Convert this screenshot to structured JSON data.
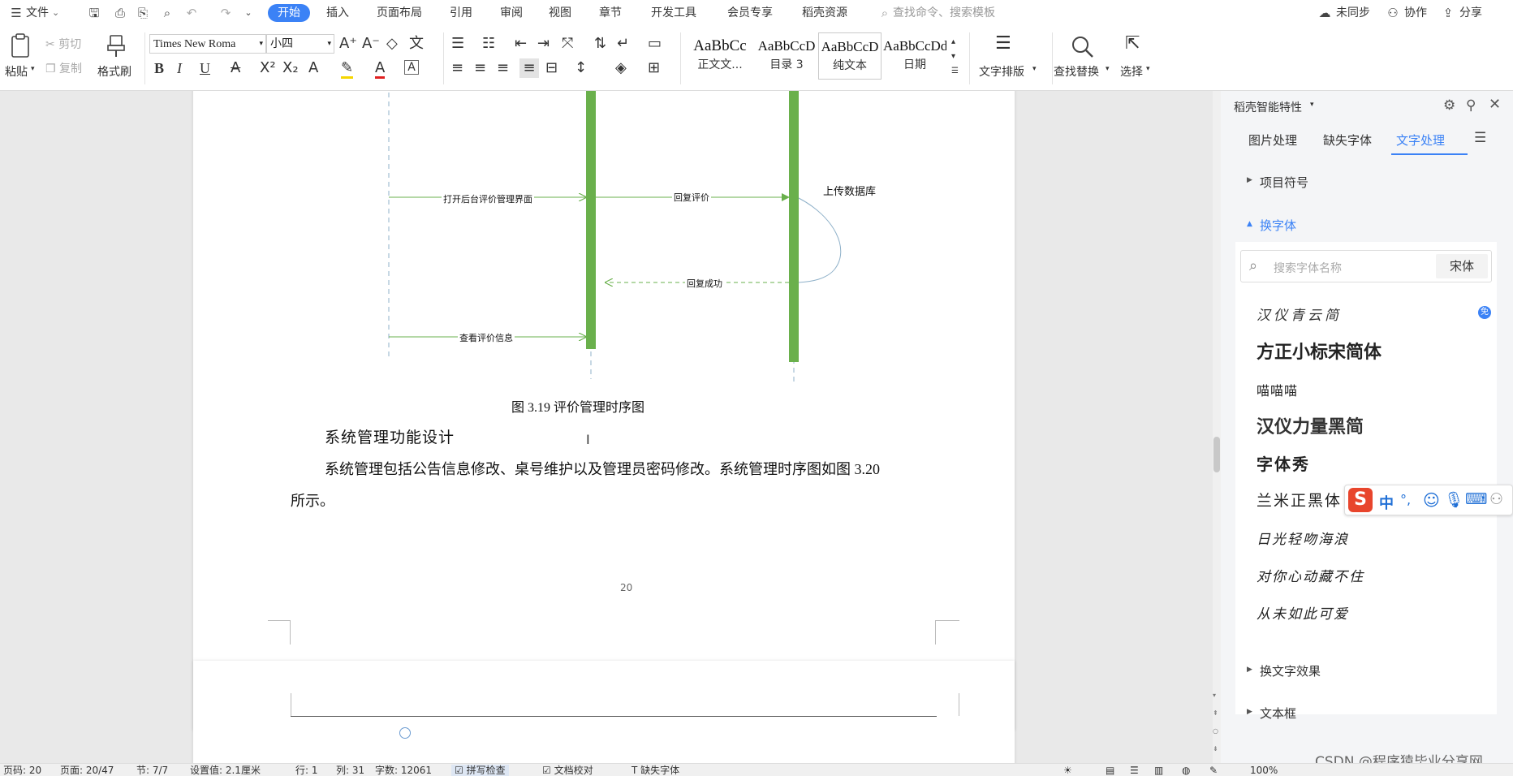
{
  "menubar": {
    "file_label": "文件",
    "tabs": [
      "开始",
      "插入",
      "页面布局",
      "引用",
      "审阅",
      "视图",
      "章节",
      "开发工具",
      "会员专享",
      "稻壳资源"
    ],
    "search_placeholder": "查找命令、搜索模板",
    "sync_label": "未同步",
    "collab_label": "协作",
    "share_label": "分享"
  },
  "ribbon": {
    "paste_label": "粘贴",
    "cut_label": "剪切",
    "copy_label": "复制",
    "format_painter_label": "格式刷",
    "font_name": "Times New Roma",
    "font_size": "小四",
    "styles": [
      {
        "sample": "AaBbCc",
        "name": "正文文..."
      },
      {
        "sample": "AaBbCcD",
        "name": "目录 3"
      },
      {
        "sample": "AaBbCcD",
        "name": "纯文本"
      },
      {
        "sample": "AaBbCcDd",
        "name": "日期"
      }
    ],
    "text_layout_label": "文字排版",
    "find_replace_label": "查找替换",
    "select_label": "选择"
  },
  "document": {
    "diagram_labels": {
      "upload_db": "上传数据库",
      "open_admin": "打开后台评价管理界面",
      "reply": "回复评价",
      "reply_success": "回复成功",
      "view_info": "查看评价信息"
    },
    "figure_caption": "图 3.19 评价管理时序图",
    "heading": "系统管理功能设计",
    "paragraph_line1": "系统管理包括公告信息修改、桌号维护以及管理员密码修改。系统管理时序图如图 3.20",
    "paragraph_line2": "所示。",
    "page_number": "20"
  },
  "panel": {
    "title": "稻壳智能特性",
    "tabs": [
      "图片处理",
      "缺失字体",
      "文字处理"
    ],
    "sections": {
      "bullets": "项目符号",
      "change_font": "换字体",
      "change_effect": "换文字效果",
      "textbox": "文本框"
    },
    "font_search_placeholder": "搜索字体名称",
    "current_font": "宋体",
    "fonts": [
      "汉仪青云简",
      "方正小标宋简体",
      "喵喵喵",
      "汉仪力量黑简",
      "字体秀",
      "兰米正黑体",
      "日光轻吻海浪",
      "对你心动藏不住",
      "从未如此可爱"
    ],
    "free_badge": "免"
  },
  "ime": {
    "lang": "中",
    "punct": "°,"
  },
  "statusbar": {
    "page_info": "页码: 20",
    "pages": "页面: 20/47",
    "section": "节: 7/7",
    "setting": "设置值: 2.1厘米",
    "row": "行: 1",
    "col": "列: 31",
    "words": "字数: 12061",
    "spell": "拼写检查",
    "doc_check": "文档校对",
    "missing_font": "缺失字体",
    "zoom": "100%"
  },
  "watermark": "CSDN @程序猿毕业分享网",
  "colors": {
    "accent": "#3b82f6",
    "lifeline_bar": "#6ab04c",
    "arrow": "#6ab04c"
  }
}
